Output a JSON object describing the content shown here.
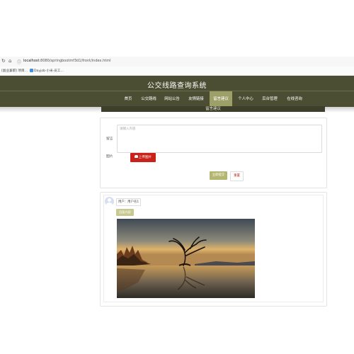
{
  "browser": {
    "url_host": "localhost",
    "url_path": ":8080/springbootmf3d1/front/index.html",
    "bookmarks": [
      "[副业兼职] 项目…",
      "Dayjob·小米·员工…"
    ]
  },
  "site": {
    "title": "公交线路查询系统",
    "nav": [
      "首页",
      "公交路线",
      "网站公告",
      "友情链接",
      "留言建议",
      "个人中心",
      "后台管理",
      "在线咨询"
    ],
    "active_nav": "留言建议",
    "section_title": "留言建议"
  },
  "form": {
    "content_label": "留言",
    "content_placeholder": "请输入内容",
    "image_label": "图片",
    "upload_label": "上传图片",
    "submit_label": "立即提交",
    "reset_label": "重置"
  },
  "comment": {
    "username": "用户：用户名1",
    "reply_label": "回复内容"
  },
  "colors": {
    "header_bg": "#4c4e33",
    "nav_active": "#9ea06a",
    "upload_red": "#c8221a",
    "submit_olive": "#b4b66f"
  }
}
